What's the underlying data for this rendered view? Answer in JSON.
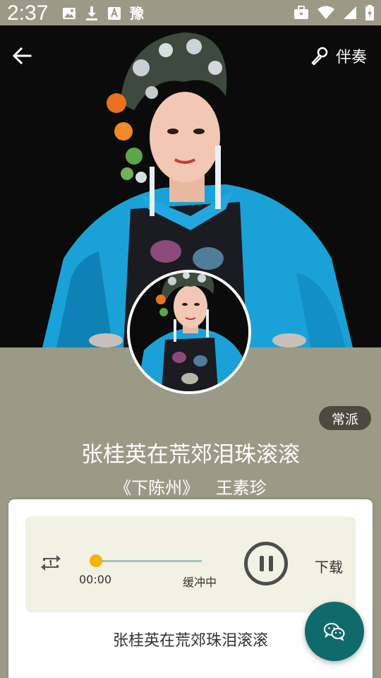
{
  "status_bar": {
    "time": "2:37",
    "ime_label": "豫",
    "left_icons": [
      "image-icon",
      "download-icon",
      "keyboard-a-icon"
    ],
    "right_icons": [
      "briefcase-icon",
      "wifi-icon",
      "signal-icon",
      "battery-icon"
    ]
  },
  "header": {
    "back_icon": "arrow-left-icon",
    "accompany_icon": "microphone-icon",
    "accompany_label": "伴奏"
  },
  "song": {
    "style_badge": "常派",
    "title": "张桂英在荒郊泪珠滚滚",
    "opera": "《下陈州》",
    "performer": "王素珍"
  },
  "player": {
    "repeat_icon": "repeat-one-icon",
    "current_time": "00:00",
    "buffer_status": "缓冲中",
    "progress": 0.0,
    "pause_icon": "pause-icon",
    "download_label": "下载"
  },
  "lyrics": {
    "current_line": "张桂英在荒郊珠泪滚滚"
  },
  "fab": {
    "icon": "wechat-icon"
  },
  "colors": {
    "status_bar_bg": "#9b9a86",
    "accent_orange": "#f5b400",
    "fab_teal": "#0f6b6b",
    "card_bg": "#f2f2e4",
    "badge_bg": "#4a4a40"
  }
}
